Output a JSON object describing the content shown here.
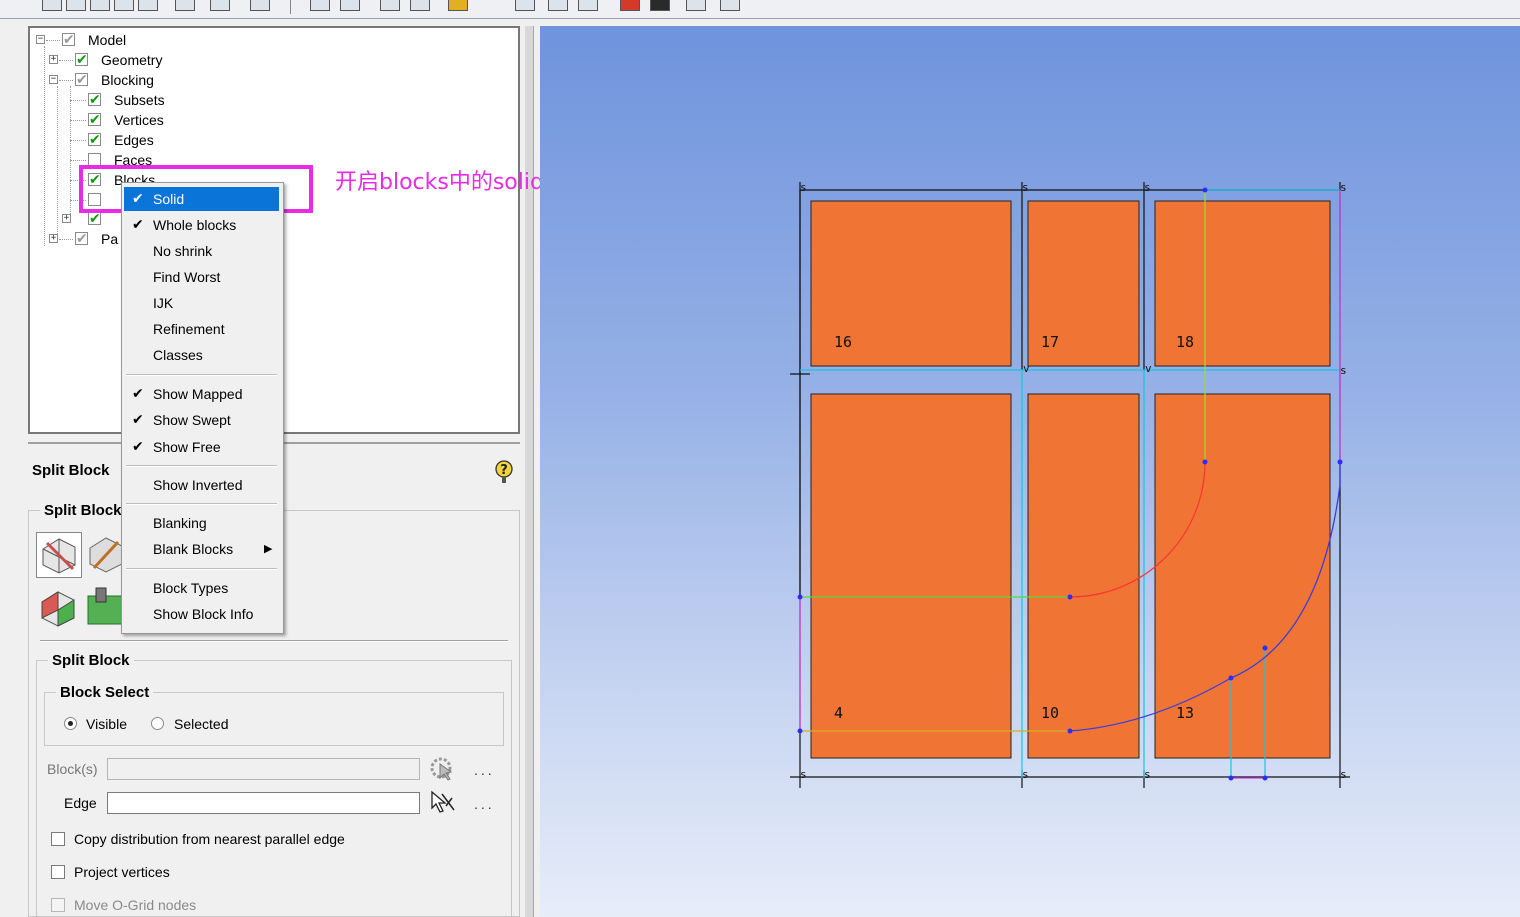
{
  "tree": {
    "items": [
      {
        "label": "Model"
      },
      {
        "label": "Geometry"
      },
      {
        "label": "Blocking"
      },
      {
        "label": "Subsets"
      },
      {
        "label": "Vertices"
      },
      {
        "label": "Edges"
      },
      {
        "label": "Faces"
      },
      {
        "label": "Blocks"
      },
      {
        "label": "Pa"
      }
    ]
  },
  "annotation": {
    "text": "开启blocks中的solid，便于查看块",
    "color": "#e82be4"
  },
  "context_menu": {
    "items": [
      {
        "label": "Solid",
        "checked": true,
        "active": true
      },
      {
        "label": "Whole blocks",
        "checked": true
      },
      {
        "label": "No shrink",
        "checked": false
      },
      {
        "label": "Find Worst",
        "checked": false
      },
      {
        "label": "IJK",
        "checked": false
      },
      {
        "label": "Refinement",
        "checked": false
      },
      {
        "label": "Classes",
        "checked": false
      },
      {
        "label": "Show Mapped",
        "checked": true
      },
      {
        "label": "Show Swept",
        "checked": true
      },
      {
        "label": "Show Free",
        "checked": true
      },
      {
        "label": "Show Inverted",
        "checked": false
      },
      {
        "label": "Blanking",
        "checked": false
      },
      {
        "label": "Blank Blocks",
        "checked": false,
        "submenu": true
      },
      {
        "label": "Block Types",
        "checked": false
      },
      {
        "label": "Show Block Info",
        "checked": false
      }
    ]
  },
  "split_panel": {
    "title": "Split Block",
    "toolbar_group": "Split Block",
    "group_title": "Split Block",
    "block_select_title": "Block Select",
    "radio_visible": "Visible",
    "radio_selected": "Selected",
    "blocks_label": "Block(s)",
    "edge_label": "Edge",
    "dots": "...",
    "opt_copy": "Copy distribution from nearest parallel edge",
    "opt_project": "Project vertices",
    "opt_move": "Move O-Grid nodes"
  },
  "viewport": {
    "block_color": "#f07535",
    "block_labels": [
      "16",
      "17",
      "18",
      "4",
      "10",
      "13"
    ],
    "vertex_label_s": "s",
    "vertex_label_v": "v"
  }
}
